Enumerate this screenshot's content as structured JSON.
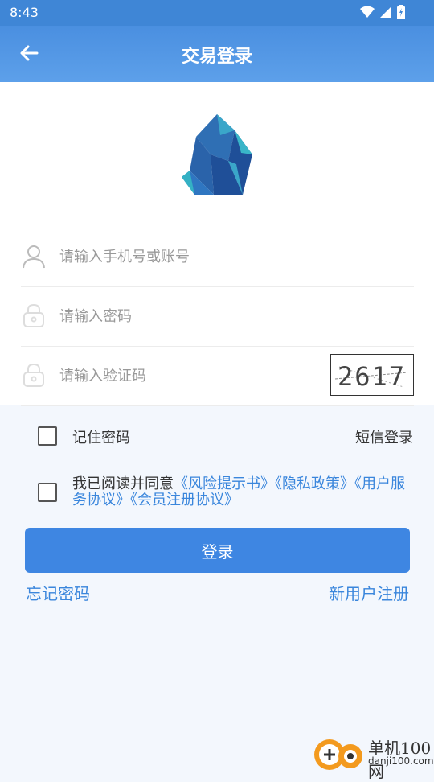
{
  "status_bar": {
    "time": "8:43"
  },
  "header": {
    "title": "交易登录"
  },
  "form": {
    "account_placeholder": "请输入手机号或账号",
    "password_placeholder": "请输入密码",
    "captcha_placeholder": "请输入验证码",
    "captcha_text": "2617"
  },
  "options": {
    "remember_label": "记住密码",
    "sms_login": "短信登录"
  },
  "agreement": {
    "prefix": "我已阅读并同意",
    "links": [
      "《风险提示书》",
      "《隐私政策》",
      "《用户服务协议》",
      "《会员注册协议》"
    ]
  },
  "login_button": "登录",
  "footer": {
    "forgot": "忘记密码",
    "register": "新用户注册"
  },
  "watermark": {
    "line1": "单机100网",
    "line2": "danji100.com"
  },
  "colors": {
    "primary": "#3e86e2",
    "link": "#3a86dc",
    "header": "#4a8fe0"
  }
}
